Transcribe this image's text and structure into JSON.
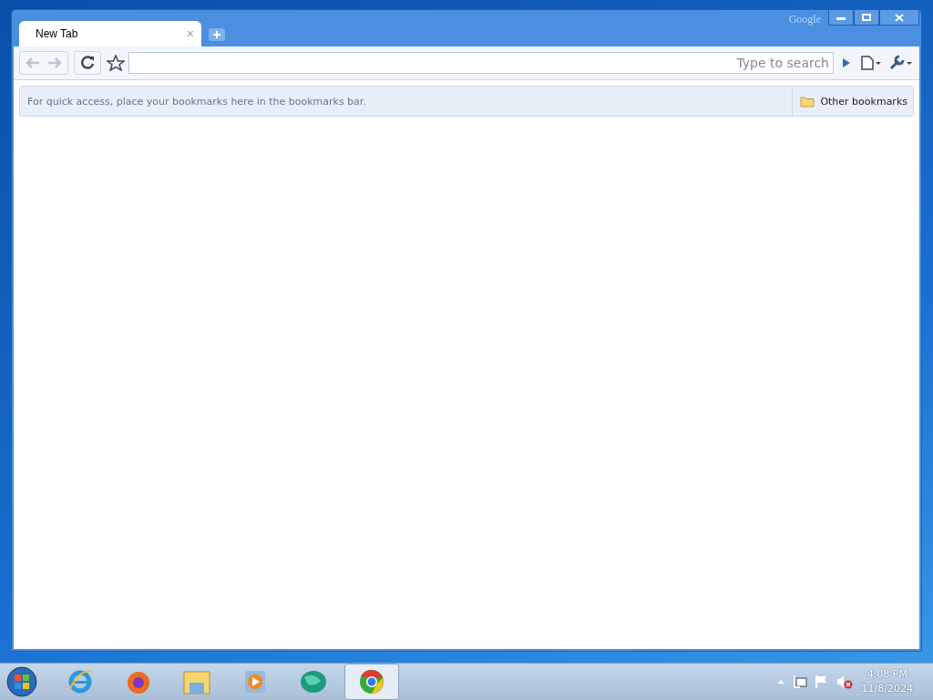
{
  "window": {
    "brand": "Google"
  },
  "tabs": [
    {
      "label": "New Tab",
      "selected": true,
      "close": "×"
    }
  ],
  "toolbar": {
    "back_disabled": true,
    "forward_disabled": true,
    "omnibox": {
      "placeholder": "Type to search"
    }
  },
  "bookmarks_bar": {
    "message": "For quick access, place your bookmarks here in the bookmarks bar.",
    "other": "Other bookmarks"
  },
  "taskbar": {
    "apps": [
      {
        "kind": "ie",
        "selected": false
      },
      {
        "kind": "firefox",
        "selected": false
      },
      {
        "kind": "explorer",
        "selected": false
      },
      {
        "kind": "media",
        "selected": false
      },
      {
        "kind": "globe",
        "selected": false
      },
      {
        "kind": "chrome",
        "selected": true
      }
    ],
    "clock": {
      "time": "4:08 PM",
      "date": "11/8/2024"
    }
  }
}
